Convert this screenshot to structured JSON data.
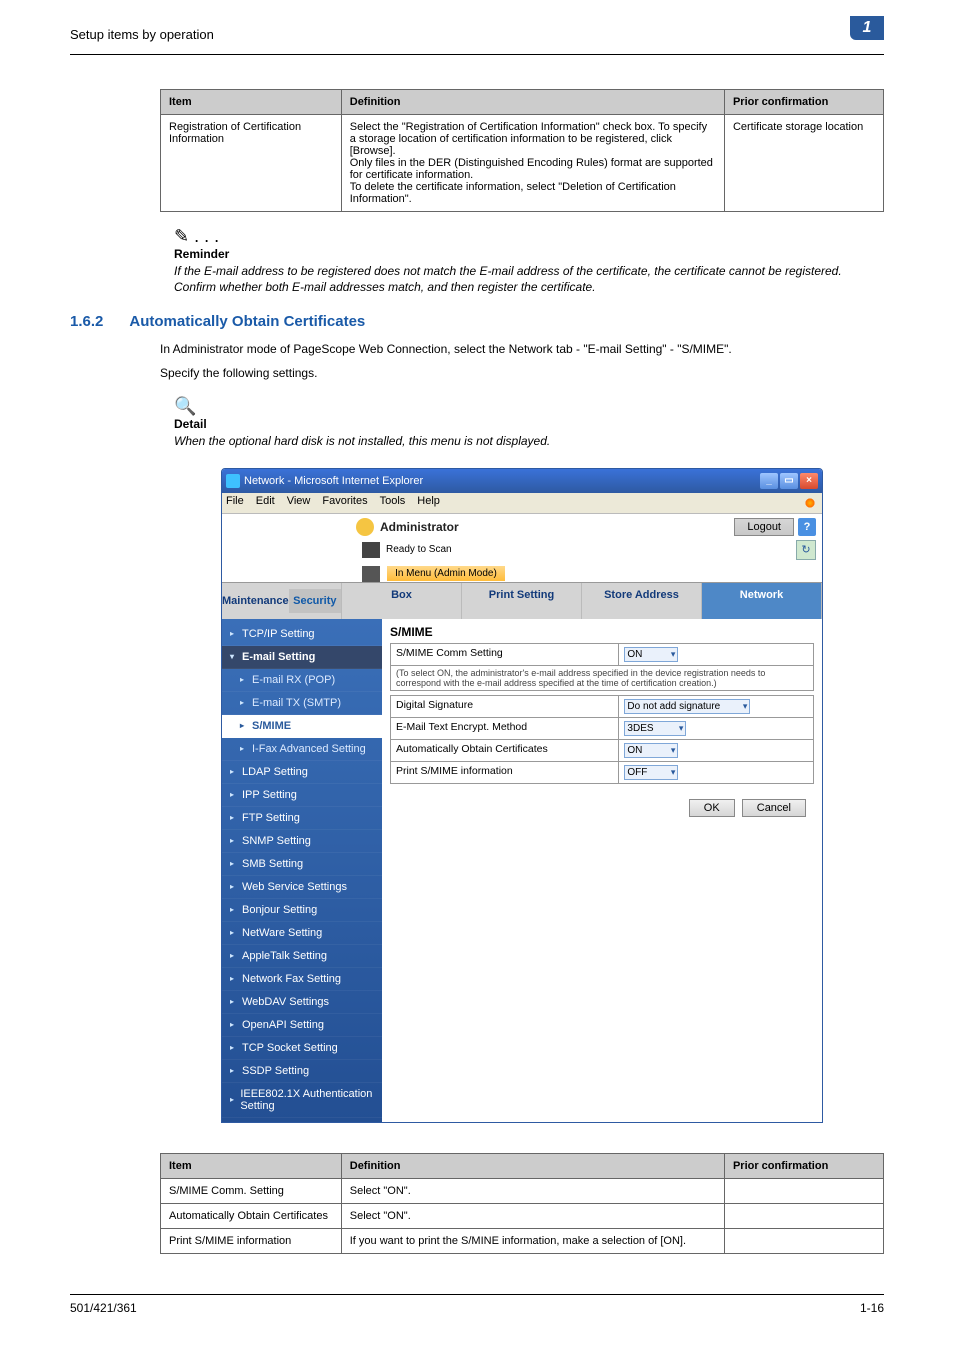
{
  "breadcrumb": "Setup items by operation",
  "chapter_tab": "1",
  "table1": {
    "headers": {
      "item": "Item",
      "definition": "Definition",
      "prior": "Prior confirmation"
    },
    "row": {
      "item": "Registration of Certification Information",
      "definition": "Select the \"Registration of Certification Information\" check box. To specify a storage location of certification information to be registered, click [Browse].\nOnly files in the DER (Distinguished Encoding Rules) format are supported for certificate information.\nTo delete the certificate information, select \"Deletion of Certification Information\".",
      "prior": "Certificate storage location"
    }
  },
  "reminder": {
    "icon": "✎ . . .",
    "label": "Reminder",
    "text": "If the E-mail address to be registered does not match the E-mail address of the certificate, the certificate cannot be registered. Confirm whether both E-mail addresses match, and then register the certificate."
  },
  "section": {
    "num": "1.6.2",
    "title": "Automatically Obtain Certificates",
    "body_line1": "In Administrator mode of PageScope Web Connection, select the Network tab - \"E-mail Setting\" - \"S/MIME\".",
    "body_line2": "Specify the following settings."
  },
  "detail": {
    "icon": "🔍",
    "label": "Detail",
    "text": "When the optional hard disk is not installed, this menu is not displayed."
  },
  "ie": {
    "title": "Network - Microsoft Internet Explorer",
    "menu": [
      "File",
      "Edit",
      "View",
      "Favorites",
      "Tools",
      "Help"
    ],
    "admin": "Administrator",
    "logout": "Logout",
    "ready": "Ready to Scan",
    "mode": "In Menu (Admin Mode)",
    "tabs": [
      "Maintenance",
      "Security",
      "Box",
      "Print Setting",
      "Store Address",
      "Network"
    ],
    "sidebar": {
      "tcpip": "TCP/IP Setting",
      "email": "E-mail Setting",
      "email_rx": "E-mail RX (POP)",
      "email_tx": "E-mail TX (SMTP)",
      "smime": "S/MIME",
      "ifax": "I-Fax Advanced Setting",
      "ldap": "LDAP Setting",
      "ipp": "IPP Setting",
      "ftp": "FTP Setting",
      "snmp": "SNMP Setting",
      "smb": "SMB Setting",
      "wsv": "Web Service Settings",
      "bonjour": "Bonjour Setting",
      "netware": "NetWare Setting",
      "appletalk": "AppleTalk Setting",
      "netfax": "Network Fax Setting",
      "webdav": "WebDAV Settings",
      "openapi": "OpenAPI Setting",
      "tcpsock": "TCP Socket Setting",
      "ssdp": "SSDP Setting",
      "ieee": "IEEE802.1X Authentication Setting"
    },
    "panel": {
      "title": "S/MIME",
      "rows": {
        "comm": {
          "label": "S/MIME Comm Setting",
          "value": "ON"
        },
        "note": "(To select ON, the administrator's e-mail address specified in the device registration needs to correspond with the e-mail address specified at the time of certification creation.)",
        "digsig": {
          "label": "Digital Signature",
          "value": "Do not add signature"
        },
        "encrypt": {
          "label": "E-Mail Text Encrypt. Method",
          "value": "3DES"
        },
        "auto": {
          "label": "Automatically Obtain Certificates",
          "value": "ON"
        },
        "print": {
          "label": "Print S/MIME information",
          "value": "OFF"
        }
      },
      "ok": "OK",
      "cancel": "Cancel"
    }
  },
  "table2": {
    "headers": {
      "item": "Item",
      "definition": "Definition",
      "prior": "Prior confirmation"
    },
    "rows": [
      {
        "item": "S/MIME Comm. Setting",
        "definition": "Select \"ON\".",
        "prior": ""
      },
      {
        "item": "Automatically Obtain Certificates",
        "definition": "Select \"ON\".",
        "prior": ""
      },
      {
        "item": "Print S/MIME information",
        "definition": "If you want to print the S/MINE information, make a selection of [ON].",
        "prior": ""
      }
    ]
  },
  "footer": {
    "left": "501/421/361",
    "right": "1-16"
  }
}
